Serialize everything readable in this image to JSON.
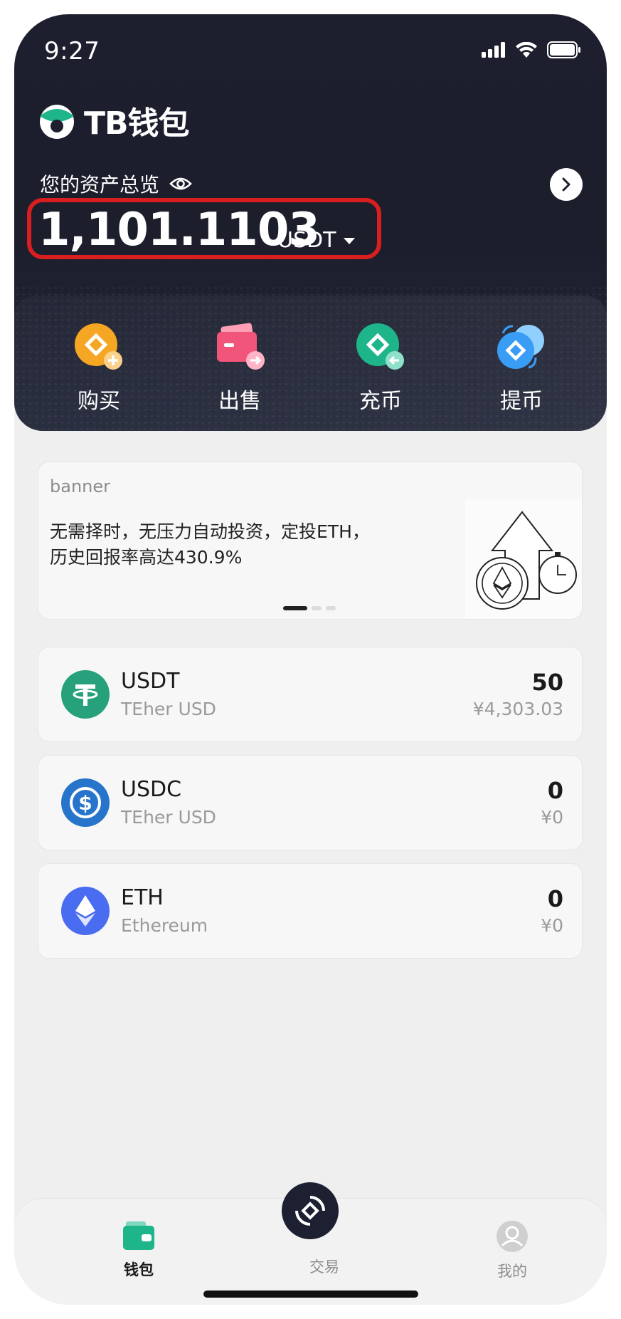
{
  "status_bar": {
    "time": "9:27"
  },
  "brand": {
    "name": "TB钱包"
  },
  "assets": {
    "label": "您的资产总览",
    "balance": "1,101.1103",
    "unit": "USDT"
  },
  "actions": [
    {
      "label": "购买",
      "icon": "buy-icon"
    },
    {
      "label": "出售",
      "icon": "sell-icon"
    },
    {
      "label": "充币",
      "icon": "deposit-icon"
    },
    {
      "label": "提币",
      "icon": "withdraw-icon"
    }
  ],
  "banner": {
    "tag": "banner",
    "line1": "无需择时，无压力自动投资，定投ETH，",
    "line2": "历史回报率高达430.9%"
  },
  "coins": [
    {
      "symbol": "USDT",
      "name": "TEher USD",
      "amount": "50",
      "value": "¥4,303.03",
      "color": "#26a17b"
    },
    {
      "symbol": "USDC",
      "name": "TEher USD",
      "amount": "0",
      "value": "¥0",
      "color": "#2775ca"
    },
    {
      "symbol": "ETH",
      "name": "Ethereum",
      "amount": "0",
      "value": "¥0",
      "color": "#4a6cf0"
    }
  ],
  "tabbar": {
    "wallet": "钱包",
    "trade": "交易",
    "mine": "我的"
  },
  "colors": {
    "header": "#1d1f2e",
    "highlight": "#d81e1e",
    "accent_green": "#1fb58b"
  }
}
